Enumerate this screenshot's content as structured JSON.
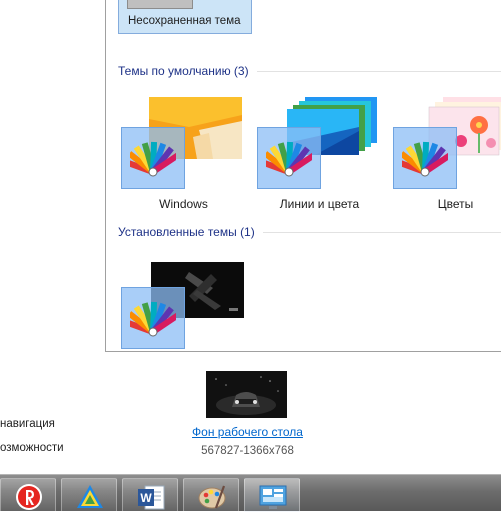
{
  "unsaved_theme": {
    "label": "Несохраненная тема"
  },
  "groups": {
    "default": {
      "header": "Темы по умолчанию (3)"
    },
    "installed": {
      "header": "Установленные темы (1)"
    }
  },
  "themes": [
    {
      "name": "Windows"
    },
    {
      "name": "Линии и цвета"
    },
    {
      "name": "Цветы"
    }
  ],
  "desktop_background": {
    "link": "Фон рабочего стола",
    "subtitle": "567827-1366x768"
  },
  "side_links": {
    "navigation": "навигация",
    "features": "озможности"
  },
  "taskbar": {
    "apps": [
      {
        "icon": "yandex-browser-icon"
      },
      {
        "icon": "triangle-app-icon"
      },
      {
        "icon": "word-icon"
      },
      {
        "icon": "paint-icon"
      },
      {
        "icon": "personalization-icon"
      }
    ]
  },
  "colors": {
    "header_text": "#1e3287",
    "link": "#0066cc",
    "selection": "#cce4f7",
    "color_tile": "#8cbef5"
  }
}
